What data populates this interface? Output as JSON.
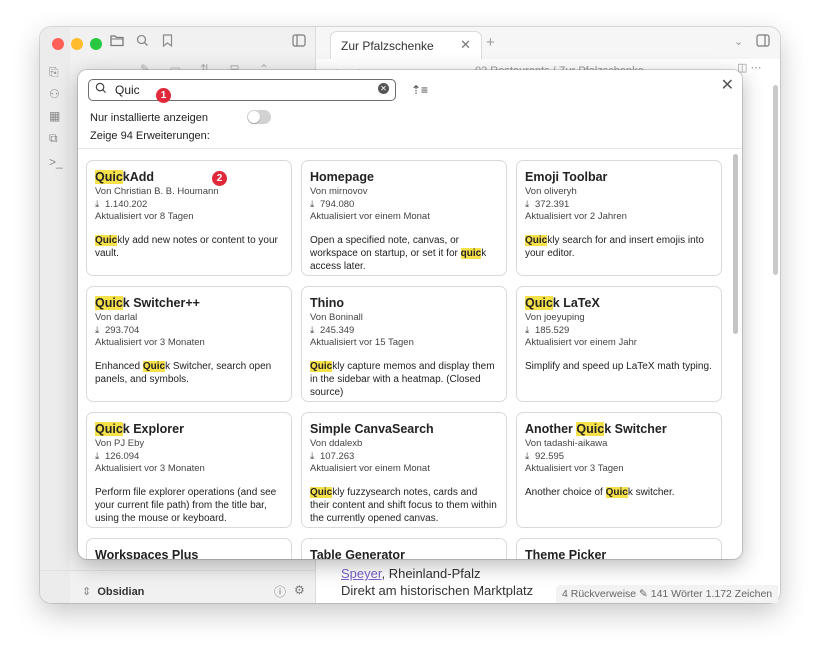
{
  "window": {
    "tab_title": "Zur Pfalzschenke",
    "breadcrumb": "02 Restaurants / Zur Pfalzschenke",
    "vault_name": "Obsidian",
    "body_link": "Speyer",
    "body_line1_rest": ", Rheinland-Pfalz",
    "body_line2": "Direkt am historischen Marktplatz",
    "status": "4 Rückverweise  ✎  141 Wörter  1.172 Zeichen"
  },
  "modal": {
    "search_value": "Quic",
    "badge1": "1",
    "badge2": "2",
    "installed_label": "Nur installierte anzeigen",
    "count_text": "Zeige 94 Erweiterungen:",
    "cards": [
      {
        "hl": "Quic",
        "rest": "kAdd",
        "author": "Von Christian B. B. Houmann",
        "downloads": "1.140.202",
        "updated": "Aktualisiert vor 8 Tagen",
        "desc_hl": "Quic",
        "desc": "kly add new notes or content to your vault."
      },
      {
        "pre": "Homepage",
        "author": "Von mirnovov",
        "downloads": "794.080",
        "updated": "Aktualisiert vor einem Monat",
        "desc_pre": "Open a specified note, canvas, or workspace on startup, or set it for ",
        "desc_hl": "quic",
        "desc": "k access later."
      },
      {
        "pre": "Emoji Toolbar",
        "author": "Von oliveryh",
        "downloads": "372.391",
        "updated": "Aktualisiert vor 2 Jahren",
        "desc_hl": "Quic",
        "desc": "kly search for and insert emojis into your editor."
      },
      {
        "hl": "Quic",
        "rest": "k Switcher++",
        "author": "Von darlal",
        "downloads": "293.704",
        "updated": "Aktualisiert vor 3 Monaten",
        "desc_pre": "Enhanced ",
        "desc_hl": "Quic",
        "desc": "k Switcher, search open panels, and symbols."
      },
      {
        "pre": "Thino",
        "author": "Von Boninall",
        "downloads": "245.349",
        "updated": "Aktualisiert vor 15 Tagen",
        "desc_hl": "Quic",
        "desc": "kly capture memos and display them in the sidebar with a heatmap. (Closed source)"
      },
      {
        "hl": "Quic",
        "rest": "k LaTeX",
        "author": "Von joeyuping",
        "downloads": "185.529",
        "updated": "Aktualisiert vor einem Jahr",
        "desc_pre": "Simplify and speed up LaTeX math typing."
      },
      {
        "hl": "Quic",
        "rest": "k Explorer",
        "author": "Von PJ Eby",
        "downloads": "126.094",
        "updated": "Aktualisiert vor 3 Monaten",
        "desc_pre": "Perform file explorer operations (and see your current file path) from the title bar, using the mouse or keyboard."
      },
      {
        "pre": "Simple CanvaSearch",
        "author": "Von ddalexb",
        "downloads": "107.263",
        "updated": "Aktualisiert vor einem Monat",
        "desc_hl": "Quic",
        "desc": "kly fuzzysearch notes, cards and their content and shift focus to them within the currently opened canvas."
      },
      {
        "pre": "Another ",
        "hl": "Quic",
        "rest": "k Switcher",
        "author": "Von tadashi-aikawa",
        "downloads": "92.595",
        "updated": "Aktualisiert vor 3 Tagen",
        "desc_pre": "Another choice of ",
        "desc_hl": "Quic",
        "desc": "k switcher."
      },
      {
        "pre": "Workspaces Plus"
      },
      {
        "pre": "Table Generator"
      },
      {
        "pre": "Theme Picker"
      }
    ]
  },
  "colors": {
    "highlight": "#f7e14a",
    "badge": "#e0293b"
  },
  "icons": [
    "folder-icon",
    "search-icon",
    "bookmark-icon",
    "sidebar-toggle-icon",
    "close-icon",
    "sort-icon",
    "download-icon",
    "help-icon",
    "settings-icon"
  ]
}
